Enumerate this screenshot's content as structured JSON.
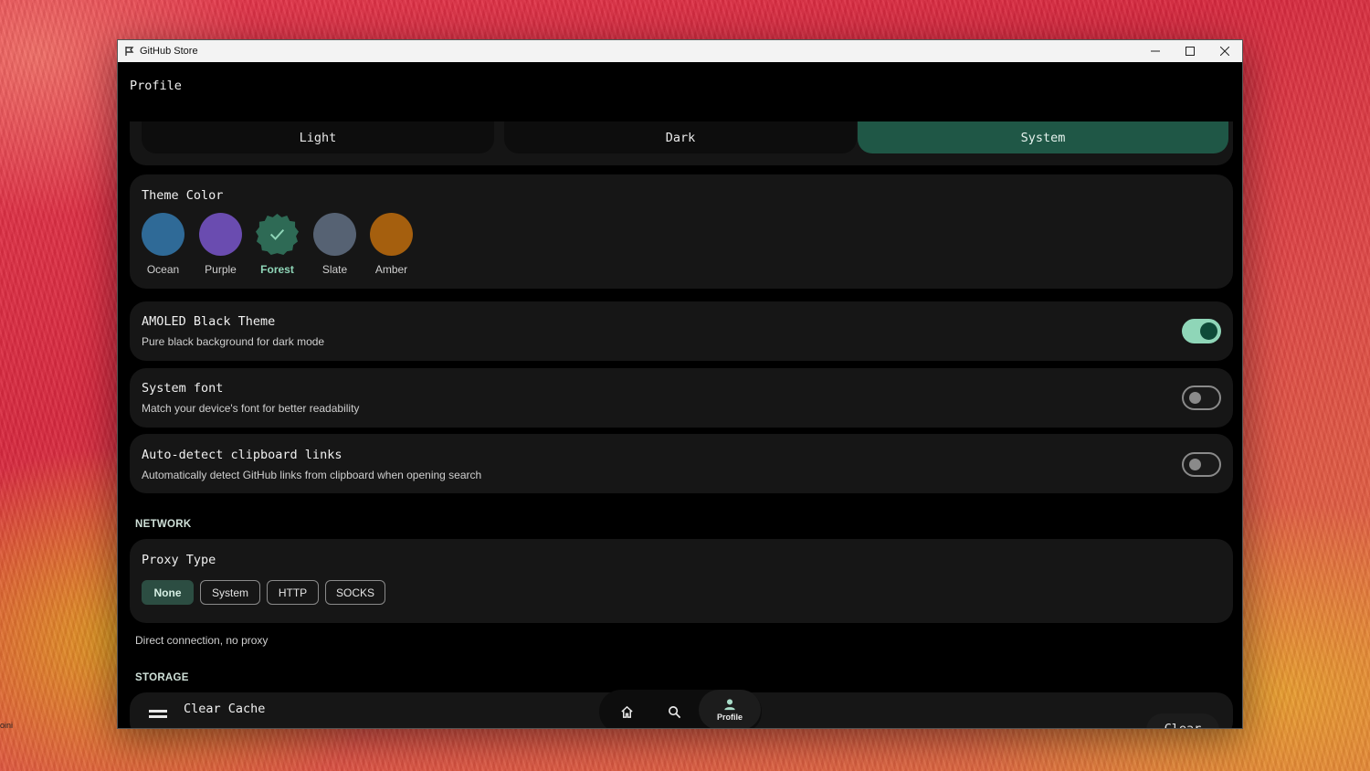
{
  "window": {
    "title": "GitHub Store"
  },
  "desktop": {
    "label": "oini"
  },
  "page": {
    "title": "Profile"
  },
  "theme_mode": {
    "options": [
      {
        "label": "Light",
        "selected": false
      },
      {
        "label": "Dark",
        "selected": false
      },
      {
        "label": "System",
        "selected": true
      }
    ]
  },
  "theme_color": {
    "title": "Theme Color",
    "swatches": [
      {
        "name": "Ocean",
        "color": "#2f6a97",
        "selected": false
      },
      {
        "name": "Purple",
        "color": "#6a4cb0",
        "selected": false
      },
      {
        "name": "Forest",
        "color": "#2e6a55",
        "selected": true
      },
      {
        "name": "Slate",
        "color": "#566273",
        "selected": false
      },
      {
        "name": "Amber",
        "color": "#a55f0e",
        "selected": false
      }
    ],
    "selected_accent": "#8fd6b8"
  },
  "settings": {
    "amoled": {
      "title": "AMOLED Black Theme",
      "subtitle": "Pure black background for dark mode",
      "enabled": true
    },
    "system_font": {
      "title": "System font",
      "subtitle": "Match your device's font for better readability",
      "enabled": false
    },
    "clipboard": {
      "title": "Auto-detect clipboard links",
      "subtitle": "Automatically detect GitHub links from clipboard when opening search",
      "enabled": false
    }
  },
  "network": {
    "section": "NETWORK",
    "proxy_title": "Proxy Type",
    "options": [
      "None",
      "System",
      "HTTP",
      "SOCKS"
    ],
    "selected": "None",
    "description": "Direct connection, no proxy"
  },
  "storage": {
    "section": "STORAGE",
    "clear_cache_title": "Clear Cache",
    "clear_button": "Clear"
  },
  "nav": {
    "items": [
      {
        "icon": "home-icon",
        "label": ""
      },
      {
        "icon": "search-icon",
        "label": ""
      },
      {
        "icon": "profile-icon",
        "label": "Profile",
        "active": true
      }
    ]
  }
}
